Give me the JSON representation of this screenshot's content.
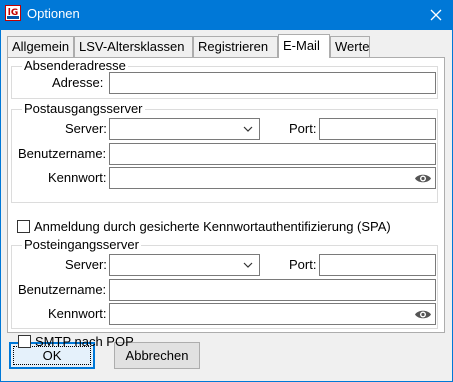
{
  "window": {
    "title": "Optionen",
    "app_icon_text": "lG"
  },
  "tabs": [
    {
      "label": "Allgemein",
      "active": false
    },
    {
      "label": "LSV-Altersklassen",
      "active": false
    },
    {
      "label": "Registrieren",
      "active": false
    },
    {
      "label": "E-Mail",
      "active": true
    },
    {
      "label": "Werte",
      "active": false
    }
  ],
  "sender": {
    "title": "Absenderadresse",
    "address_label": "Adresse:",
    "address_value": ""
  },
  "outgoing": {
    "title": "Postausgangsserver",
    "server_label": "Server:",
    "server_value": "",
    "port_label": "Port:",
    "port_value": "",
    "username_label": "Benutzername:",
    "username_value": "",
    "password_label": "Kennwort:",
    "password_value": "",
    "spa_label": "Anmeldung durch gesicherte Kennwortauthentifizierung (SPA)",
    "spa_checked": false
  },
  "incoming": {
    "title": "Posteingangsserver",
    "server_label": "Server:",
    "server_value": "",
    "port_label": "Port:",
    "port_value": "",
    "username_label": "Benutzername:",
    "username_value": "",
    "password_label": "Kennwort:",
    "password_value": "",
    "smtp_label": "SMTP nach POP",
    "smtp_checked": false
  },
  "buttons": {
    "ok": "OK",
    "cancel": "Abbrechen"
  },
  "colors": {
    "titlebar": "#0078d7",
    "dialog_bg": "#f0f0f0",
    "panel_bg": "#ffffff"
  }
}
